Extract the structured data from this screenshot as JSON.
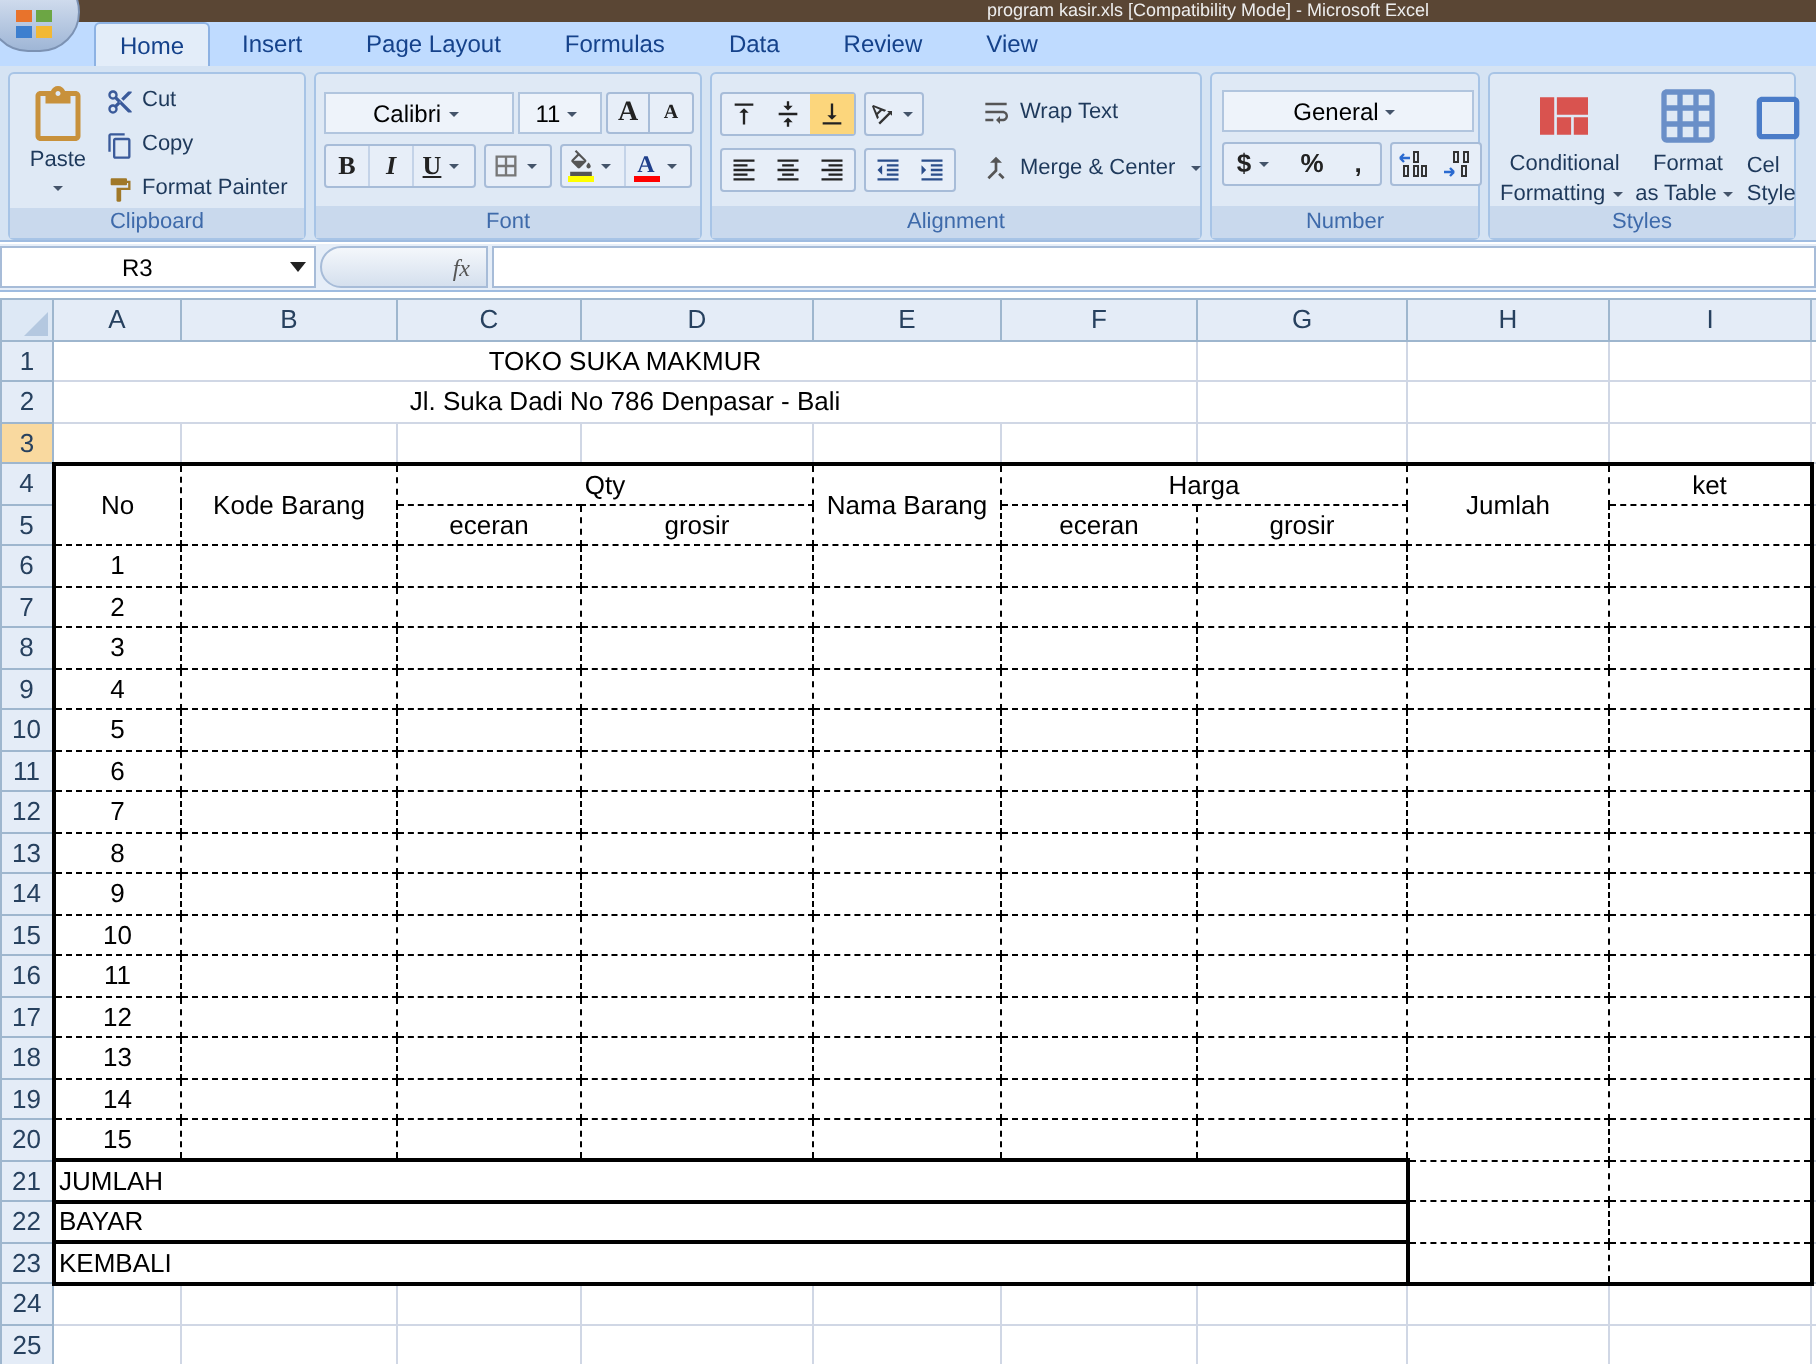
{
  "window": {
    "title": "program kasir.xls [Compatibility Mode] - Microsoft Excel"
  },
  "ribbon": {
    "tabs": [
      {
        "label": "Home",
        "selected": true
      },
      {
        "label": "Insert",
        "selected": false
      },
      {
        "label": "Page Layout",
        "selected": false
      },
      {
        "label": "Formulas",
        "selected": false
      },
      {
        "label": "Data",
        "selected": false
      },
      {
        "label": "Review",
        "selected": false
      },
      {
        "label": "View",
        "selected": false
      }
    ],
    "clipboard": {
      "label": "Clipboard",
      "paste": "Paste",
      "cut": "Cut",
      "copy": "Copy",
      "format_painter": "Format Painter"
    },
    "font": {
      "label": "Font",
      "font_name": "Calibri",
      "font_size": "11",
      "grow": "A",
      "shrink": "A",
      "bold": "B",
      "italic": "I",
      "underline": "U",
      "font_color": "A"
    },
    "alignment": {
      "label": "Alignment",
      "vertical_align": [
        {
          "selected": false
        },
        {
          "selected": false
        },
        {
          "selected": true
        }
      ],
      "wrap_text": "Wrap Text",
      "merge_center": "Merge & Center"
    },
    "number": {
      "label": "Number",
      "format": "General",
      "currency": "$",
      "percent": "%",
      "comma": ","
    },
    "styles": {
      "label": "Styles",
      "conditional_formatting": [
        "Conditional",
        "Formatting"
      ],
      "format_as_table": [
        "Format",
        "as Table"
      ],
      "cell_styles": [
        "Cel",
        "Style"
      ]
    }
  },
  "formula_bar": {
    "name_box": "R3",
    "fx_label": "fx"
  },
  "sheet": {
    "columns": [
      "A",
      "B",
      "C",
      "D",
      "E",
      "F",
      "G",
      "H",
      "I"
    ],
    "row_headers": [
      {
        "label": "1",
        "selected": false
      },
      {
        "label": "2",
        "selected": false
      },
      {
        "label": "3",
        "selected": true
      },
      {
        "label": "4",
        "selected": false
      },
      {
        "label": "5",
        "selected": false
      },
      {
        "label": "6",
        "selected": false
      },
      {
        "label": "7",
        "selected": false
      },
      {
        "label": "8",
        "selected": false
      },
      {
        "label": "9",
        "selected": false
      },
      {
        "label": "10",
        "selected": false
      },
      {
        "label": "11",
        "selected": false
      },
      {
        "label": "12",
        "selected": false
      },
      {
        "label": "13",
        "selected": false
      },
      {
        "label": "14",
        "selected": false
      },
      {
        "label": "15",
        "selected": false
      },
      {
        "label": "16",
        "selected": false
      },
      {
        "label": "17",
        "selected": false
      },
      {
        "label": "18",
        "selected": false
      },
      {
        "label": "19",
        "selected": false
      },
      {
        "label": "20",
        "selected": false
      },
      {
        "label": "21",
        "selected": false
      },
      {
        "label": "22",
        "selected": false
      },
      {
        "label": "23",
        "selected": false
      },
      {
        "label": "24",
        "selected": false
      },
      {
        "label": "25",
        "selected": false
      }
    ],
    "title": "TOKO SUKA MAKMUR",
    "address": "Jl. Suka Dadi No 786 Denpasar - Bali",
    "header": {
      "no": "No",
      "kode_barang": "Kode Barang",
      "qty": "Qty",
      "qty_eceran": "eceran",
      "qty_grosir": "grosir",
      "nama_barang": "Nama Barang",
      "harga": "Harga",
      "harga_eceran": "eceran",
      "harga_grosir": "grosir",
      "jumlah": "Jumlah",
      "ket": "ket"
    },
    "item_numbers": [
      "1",
      "2",
      "3",
      "4",
      "5",
      "6",
      "7",
      "8",
      "9",
      "10",
      "11",
      "12",
      "13",
      "14",
      "15"
    ],
    "totals": [
      "JUMLAH",
      "BAYAR",
      "KEMBALI"
    ]
  }
}
